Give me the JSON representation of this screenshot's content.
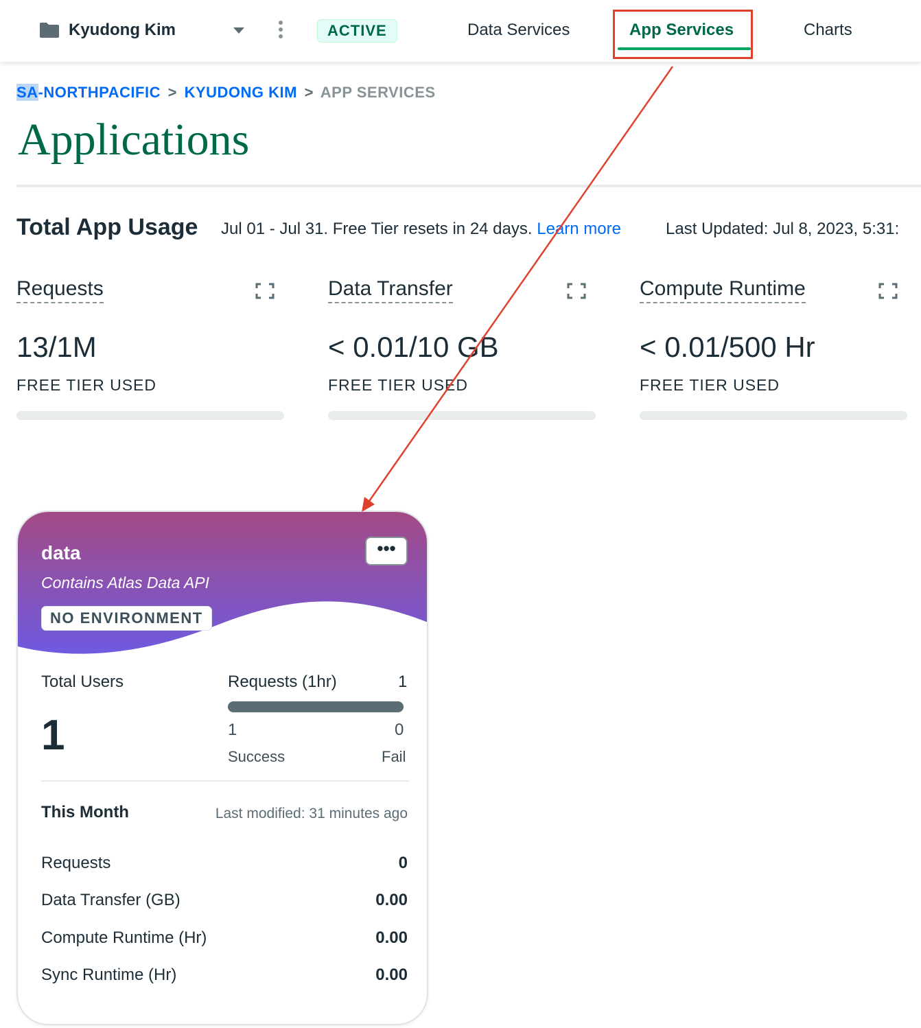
{
  "topbar": {
    "project_name": "Kyudong Kim",
    "status_badge": "ACTIVE",
    "nav": {
      "data_services": "Data Services",
      "app_services": "App Services",
      "charts": "Charts"
    }
  },
  "breadcrumb": {
    "org_selected": "SA",
    "org_rest": "-NORTHPACIFIC",
    "project": "KYUDONG KIM",
    "current": "APP SERVICES",
    "separator": ">"
  },
  "page_title": "Applications",
  "usage": {
    "title": "Total App Usage",
    "description": "Jul 01 - Jul 31. Free Tier resets in 24 days.",
    "learn_more": "Learn more",
    "last_updated": "Last Updated: Jul 8, 2023, 5:31:",
    "metrics": [
      {
        "label": "Requests",
        "value": "13/1M",
        "sub": "FREE TIER USED",
        "fill_percent": 0
      },
      {
        "label": "Data Transfer",
        "value": "< 0.01/10 GB",
        "sub": "FREE TIER USED",
        "fill_percent": 0
      },
      {
        "label": "Compute Runtime",
        "value": "< 0.01/500 Hr",
        "sub": "FREE TIER USED",
        "fill_percent": 0
      }
    ]
  },
  "app_card": {
    "name": "data",
    "description": "Contains Atlas Data API",
    "environment": "NO ENVIRONMENT",
    "more_label": "•••",
    "total_users_label": "Total Users",
    "total_users": "1",
    "requests_label": "Requests (1hr)",
    "requests_count": "1",
    "success_count": "1",
    "fail_count": "0",
    "success_label": "Success",
    "fail_label": "Fail",
    "month_title": "This Month",
    "last_modified": "Last modified: 31 minutes ago",
    "rows": [
      {
        "label": "Requests",
        "value": "0"
      },
      {
        "label": "Data Transfer (GB)",
        "value": "0.00"
      },
      {
        "label": "Compute Runtime (Hr)",
        "value": "0.00"
      },
      {
        "label": "Sync Runtime (Hr)",
        "value": "0.00"
      }
    ]
  },
  "colors": {
    "brand_green": "#00684a",
    "accent_green": "#00a35c",
    "link_blue": "#016bf8",
    "annotation_red": "#e0412f",
    "card_gradient_top": "#a34a84",
    "card_gradient_bottom": "#6f5ae0"
  },
  "icons": [
    "folder-icon",
    "caret-down-icon",
    "kebab-menu-icon",
    "expand-icon",
    "more-options-icon"
  ]
}
